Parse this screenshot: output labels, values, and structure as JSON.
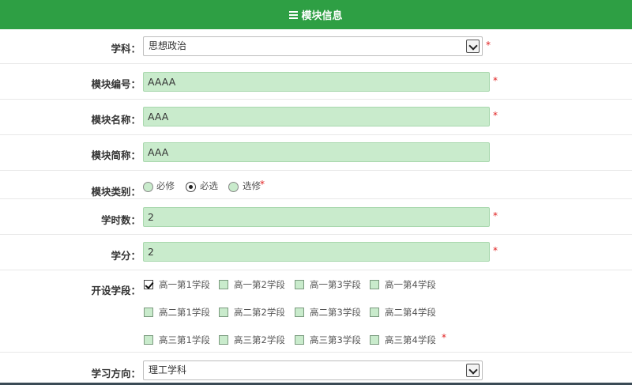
{
  "header": {
    "title": "模块信息",
    "icon": "menu-icon"
  },
  "subject": {
    "label": "学科：",
    "value": "思想政治",
    "required": "*"
  },
  "module_code": {
    "label": "模块编号：",
    "value": "AAAA",
    "required": "*"
  },
  "module_name": {
    "label": "模块名称：",
    "value": "AAA",
    "required": "*"
  },
  "module_short": {
    "label": "模块简称：",
    "value": "AAA"
  },
  "module_type": {
    "label": "模块类别：",
    "options": [
      "必修",
      "必选",
      "选修"
    ],
    "selected": "必选",
    "required": "*"
  },
  "hours": {
    "label": "学时数：",
    "value": "2",
    "required": "*"
  },
  "credit": {
    "label": "学分：",
    "value": "2",
    "required": "*"
  },
  "terms": {
    "label": "开设学段：",
    "rows": [
      [
        "高一第1学段",
        "高一第2学段",
        "高一第3学段",
        "高一第4学段"
      ],
      [
        "高二第1学段",
        "高二第2学段",
        "高二第3学段",
        "高二第4学段"
      ],
      [
        "高三第1学段",
        "高三第2学段",
        "高三第3学段",
        "高三第4学段"
      ]
    ],
    "checked": [
      "高一第1学段"
    ],
    "required": "*"
  },
  "direction": {
    "label": "学习方向：",
    "value": "理工学科"
  },
  "colors": {
    "header": "#2e9f44",
    "field": "#c9ebcc",
    "required": "#e02020"
  }
}
